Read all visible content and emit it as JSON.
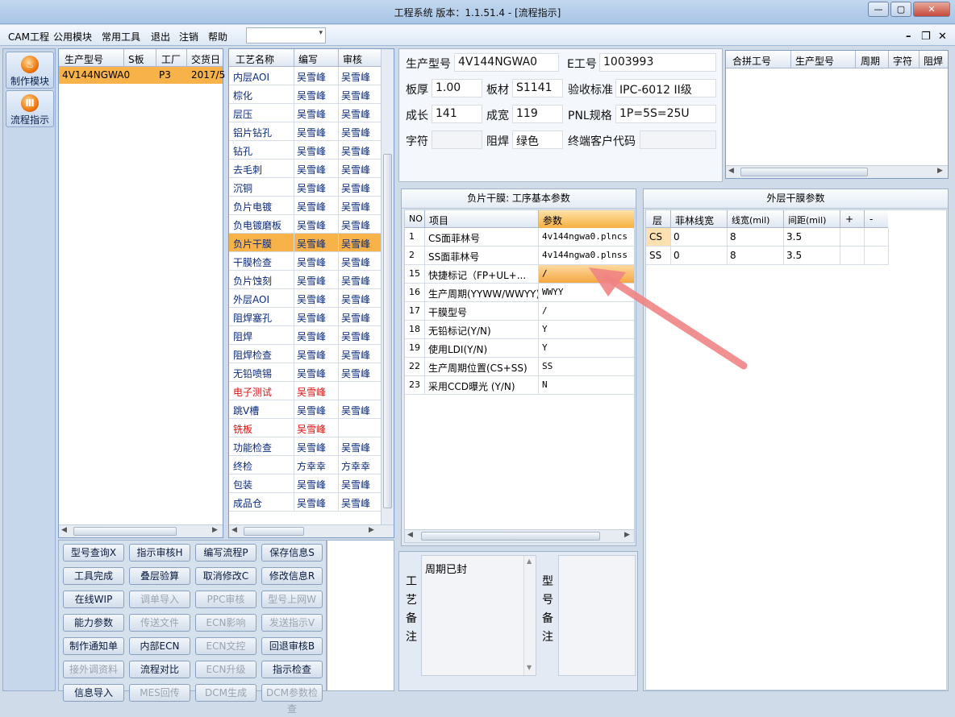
{
  "window": {
    "title": "工程系统  版本：1.1.51.4 - [流程指示]",
    "min_label": "—",
    "max_label": "▢",
    "close_label": "✕"
  },
  "menu": {
    "items": [
      "CAM工程",
      "公用模块",
      "常用工具",
      "退出",
      "注销",
      "帮助"
    ],
    "combo_arrow": "▾",
    "mdi": [
      "–",
      "❐",
      "✕"
    ]
  },
  "sidebar": {
    "items": [
      {
        "label": "制作模块",
        "icon": "flame-icon",
        "glyph": "♨"
      },
      {
        "label": "流程指示",
        "icon": "flow-icon",
        "glyph": "Ⅲ"
      }
    ]
  },
  "order_list": {
    "headers": [
      "生产型号",
      "S板",
      "工厂",
      "交货日"
    ],
    "rows": [
      [
        "4V144NGWA0",
        "",
        "P3",
        "2017/5"
      ]
    ]
  },
  "process_list": {
    "headers": [
      "工艺名称",
      "编写",
      "审核"
    ],
    "rows": [
      {
        "name": "内层AOI",
        "writer": "吴雪峰",
        "auditor": "吴雪峰",
        "red": false
      },
      {
        "name": "棕化",
        "writer": "吴雪峰",
        "auditor": "吴雪峰",
        "red": false
      },
      {
        "name": "层压",
        "writer": "吴雪峰",
        "auditor": "吴雪峰",
        "red": false
      },
      {
        "name": "铝片钻孔",
        "writer": "吴雪峰",
        "auditor": "吴雪峰",
        "red": false
      },
      {
        "name": "钻孔",
        "writer": "吴雪峰",
        "auditor": "吴雪峰",
        "red": false
      },
      {
        "name": "去毛刺",
        "writer": "吴雪峰",
        "auditor": "吴雪峰",
        "red": false
      },
      {
        "name": "沉铜",
        "writer": "吴雪峰",
        "auditor": "吴雪峰",
        "red": false
      },
      {
        "name": "负片电镀",
        "writer": "吴雪峰",
        "auditor": "吴雪峰",
        "red": false
      },
      {
        "name": "负电镀磨板",
        "writer": "吴雪峰",
        "auditor": "吴雪峰",
        "red": false
      },
      {
        "name": "负片干膜",
        "writer": "吴雪峰",
        "auditor": "吴雪峰",
        "red": false,
        "selected": true
      },
      {
        "name": "干膜检查",
        "writer": "吴雪峰",
        "auditor": "吴雪峰",
        "red": false
      },
      {
        "name": "负片蚀刻",
        "writer": "吴雪峰",
        "auditor": "吴雪峰",
        "red": false
      },
      {
        "name": "外层AOI",
        "writer": "吴雪峰",
        "auditor": "吴雪峰",
        "red": false
      },
      {
        "name": "阻焊塞孔",
        "writer": "吴雪峰",
        "auditor": "吴雪峰",
        "red": false
      },
      {
        "name": "阻焊",
        "writer": "吴雪峰",
        "auditor": "吴雪峰",
        "red": false
      },
      {
        "name": "阻焊检查",
        "writer": "吴雪峰",
        "auditor": "吴雪峰",
        "red": false
      },
      {
        "name": "无铅喷锡",
        "writer": "吴雪峰",
        "auditor": "吴雪峰",
        "red": false
      },
      {
        "name": "电子测试",
        "writer": "吴雪峰",
        "auditor": "",
        "red": true
      },
      {
        "name": "跳V槽",
        "writer": "吴雪峰",
        "auditor": "吴雪峰",
        "red": false
      },
      {
        "name": "铣板",
        "writer": "吴雪峰",
        "auditor": "",
        "red": true
      },
      {
        "name": "功能检查",
        "writer": "吴雪峰",
        "auditor": "吴雪峰",
        "red": false
      },
      {
        "name": "终检",
        "writer": "方幸幸",
        "auditor": "方幸幸",
        "red": false
      },
      {
        "name": "包装",
        "writer": "吴雪峰",
        "auditor": "吴雪峰",
        "red": false
      },
      {
        "name": "成品仓",
        "writer": "吴雪峰",
        "auditor": "吴雪峰",
        "red": false
      }
    ]
  },
  "info": {
    "model_label": "生产型号",
    "model": "4V144NGWA0",
    "ejob_label": "E工号",
    "ejob": "1003993",
    "thick_label": "板厚",
    "thick": "1.00",
    "mat_label": "板材",
    "mat": "S1141",
    "std_label": "验收标准",
    "std": "IPC-6012 II级",
    "len_label": "成长",
    "len": "141",
    "wid_label": "成宽",
    "wid": "119",
    "pnl_label": "PNL规格",
    "pnl": "1P=5S=25U",
    "char_label": "字符",
    "char": "",
    "mask_label": "阻焊",
    "mask": "绿色",
    "cust_label": "终端客户代码",
    "cust": ""
  },
  "merge": {
    "headers": [
      "合拼工号",
      "生产型号",
      "周期",
      "字符",
      "阻焊"
    ]
  },
  "params": {
    "title": "负片干膜: 工序基本参数",
    "headers": [
      "NO",
      "项目",
      "参数"
    ],
    "rows": [
      [
        "1",
        "CS面菲林号",
        "4v144ngwa0.plncs"
      ],
      [
        "2",
        "SS面菲林号",
        "4v144ngwa0.plnss"
      ],
      [
        "15",
        "快捷标记（FP+UL+...",
        "/"
      ],
      [
        "16",
        "生产周期(YYWW/WWYY)",
        "WWYY"
      ],
      [
        "17",
        "干膜型号",
        "/"
      ],
      [
        "18",
        "无铅标记(Y/N)",
        "Y"
      ],
      [
        "19",
        "使用LDI(Y/N)",
        "Y"
      ],
      [
        "22",
        "生产周期位置(CS+SS)",
        "SS"
      ],
      [
        "23",
        "采用CCD曝光 (Y/N)",
        "N"
      ]
    ]
  },
  "outer": {
    "title": "外层干膜参数",
    "headers": [
      "层",
      "菲林线宽",
      "线宽(mil)",
      "间距(mil)",
      "+",
      "-"
    ],
    "rows": [
      [
        "CS",
        "0",
        "8",
        "3.5"
      ],
      [
        "SS",
        "0",
        "8",
        "3.5"
      ]
    ]
  },
  "notes": {
    "process_label": [
      "工",
      "艺",
      "备",
      "注"
    ],
    "process_text": "周期已封",
    "model_label": [
      "型",
      "号",
      "备",
      "注"
    ],
    "model_text": ""
  },
  "buttons": [
    [
      "型号查询X",
      "指示审核H",
      "编写流程P",
      "保存信息S"
    ],
    [
      "工具完成",
      "叠层验算",
      "取消修改C",
      "修改信息R"
    ],
    [
      "在线WIP",
      "调单导入",
      "PPC审核",
      "型号上网W"
    ],
    [
      "能力参数",
      "传送文件",
      "ECN影响",
      "发送指示V"
    ],
    [
      "制作通知单",
      "内部ECN",
      "ECN文控",
      "回退审核B"
    ],
    [
      "接外调资料",
      "流程对比",
      "ECN升级",
      "指示检查"
    ],
    [
      "信息导入",
      "MES回传",
      "DCM生成",
      "DCM参数检查"
    ]
  ],
  "buttons_disabled": [
    [
      2,
      1
    ],
    [
      2,
      2
    ],
    [
      2,
      3
    ],
    [
      3,
      1
    ],
    [
      3,
      2
    ],
    [
      3,
      3
    ],
    [
      4,
      2
    ],
    [
      5,
      0
    ],
    [
      5,
      2
    ],
    [
      6,
      1
    ],
    [
      6,
      2
    ],
    [
      6,
      3
    ]
  ],
  "colors": {
    "selection": "#f8b24a",
    "red_text": "#e01010",
    "blue_text": "#0a2a7a"
  }
}
